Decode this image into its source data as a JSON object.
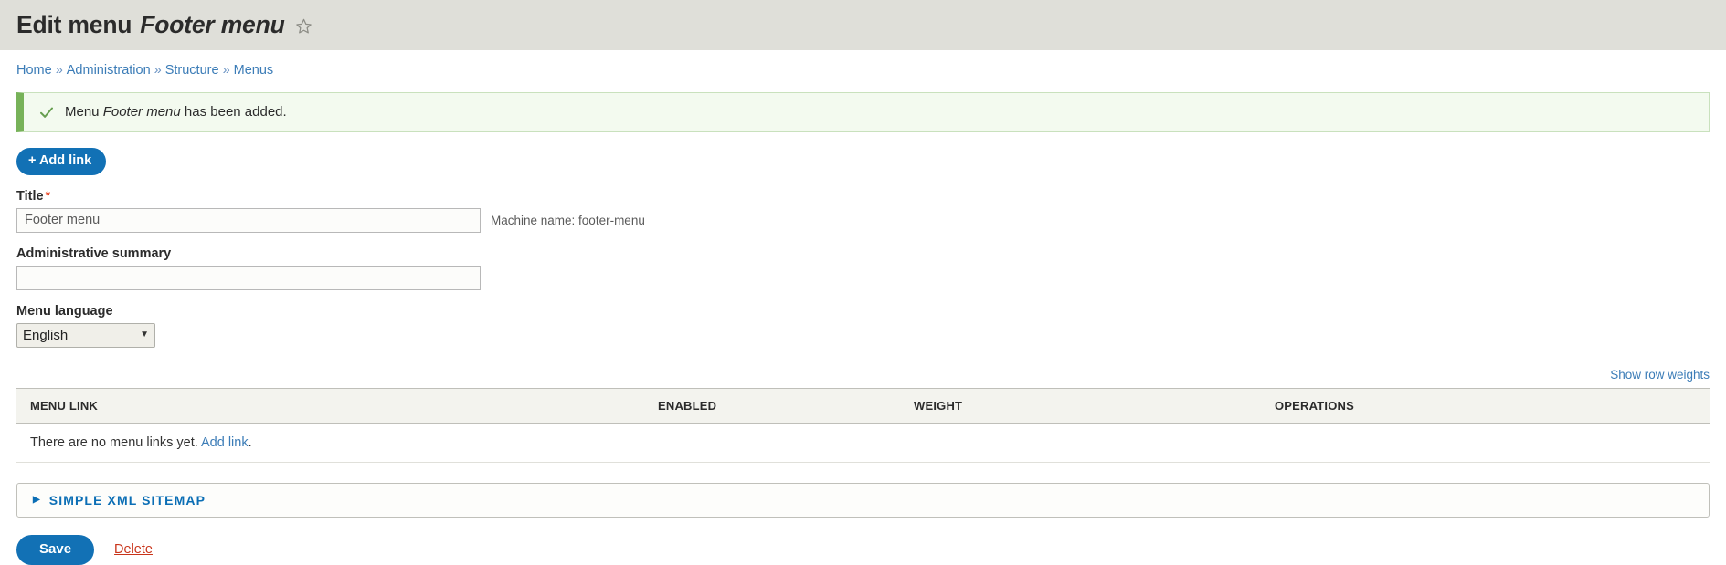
{
  "header": {
    "title_prefix": "Edit menu",
    "title_entity": "Footer menu",
    "star_icon": "star-outline-icon"
  },
  "breadcrumb": {
    "separator": "»",
    "items": [
      {
        "label": "Home"
      },
      {
        "label": "Administration"
      },
      {
        "label": "Structure"
      },
      {
        "label": "Menus"
      }
    ]
  },
  "message": {
    "icon": "check-icon",
    "text_before": "Menu ",
    "emphasis": "Footer menu",
    "text_after": " has been added.",
    "accent_color": "#77b259",
    "background_color": "#f3faef"
  },
  "actions": {
    "add_link_label": "+ Add link",
    "primary_color": "#1271b5"
  },
  "form": {
    "title_field": {
      "label": "Title",
      "required_marker": "*",
      "value": "Footer menu",
      "placeholder": ""
    },
    "machine_name": "Machine name: footer-menu",
    "summary_field": {
      "label": "Administrative summary",
      "value": "",
      "placeholder": ""
    },
    "language_field": {
      "label": "Menu language",
      "selected": "English",
      "caret_icon": "chevron-down-icon",
      "options": [
        "English"
      ]
    }
  },
  "table": {
    "toggle_weights_label": "Show row weights",
    "columns": [
      "MENU LINK",
      "ENABLED",
      "WEIGHT",
      "OPERATIONS"
    ],
    "empty_row": {
      "text_before": "There are no menu links yet. ",
      "link_label": "Add link",
      "text_after": "."
    },
    "rows": []
  },
  "details": {
    "marker_icon": "triangle-right-icon",
    "summary_label": "Simple XML sitemap",
    "expanded": false
  },
  "form_actions": {
    "save_label": "Save",
    "delete_label": "Delete",
    "delete_color": "#c9341a"
  }
}
